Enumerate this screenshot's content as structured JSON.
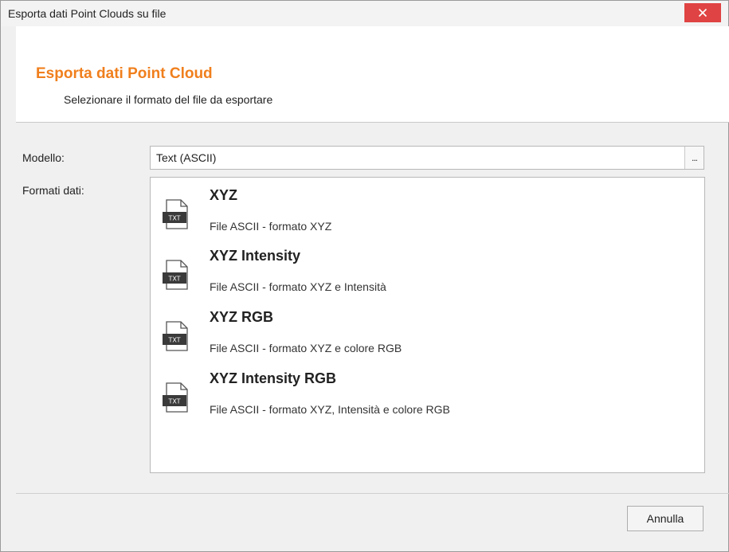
{
  "window": {
    "title": "Esporta dati Point Clouds su file"
  },
  "header": {
    "title": "Esporta dati Point Cloud",
    "subtitle": "Selezionare il formato del file da esportare"
  },
  "form": {
    "model_label": "Modello:",
    "model_value": "Text (ASCII)",
    "model_browse": "...",
    "formats_label": "Formati dati:"
  },
  "formats": [
    {
      "name": "XYZ",
      "description": "File ASCII - formato XYZ",
      "icon": "txt-file-icon",
      "icon_text": "TXT"
    },
    {
      "name": "XYZ Intensity",
      "description": "File ASCII - formato XYZ e Intensità",
      "icon": "txt-file-icon",
      "icon_text": "TXT"
    },
    {
      "name": "XYZ RGB",
      "description": "File ASCII - formato XYZ e colore RGB",
      "icon": "txt-file-icon",
      "icon_text": "TXT"
    },
    {
      "name": "XYZ Intensity RGB",
      "description": "File ASCII - formato XYZ, Intensità e colore RGB",
      "icon": "txt-file-icon",
      "icon_text": "TXT"
    }
  ],
  "footer": {
    "cancel_label": "Annulla"
  },
  "colors": {
    "accent": "#f07f1d",
    "close": "#e04343"
  }
}
